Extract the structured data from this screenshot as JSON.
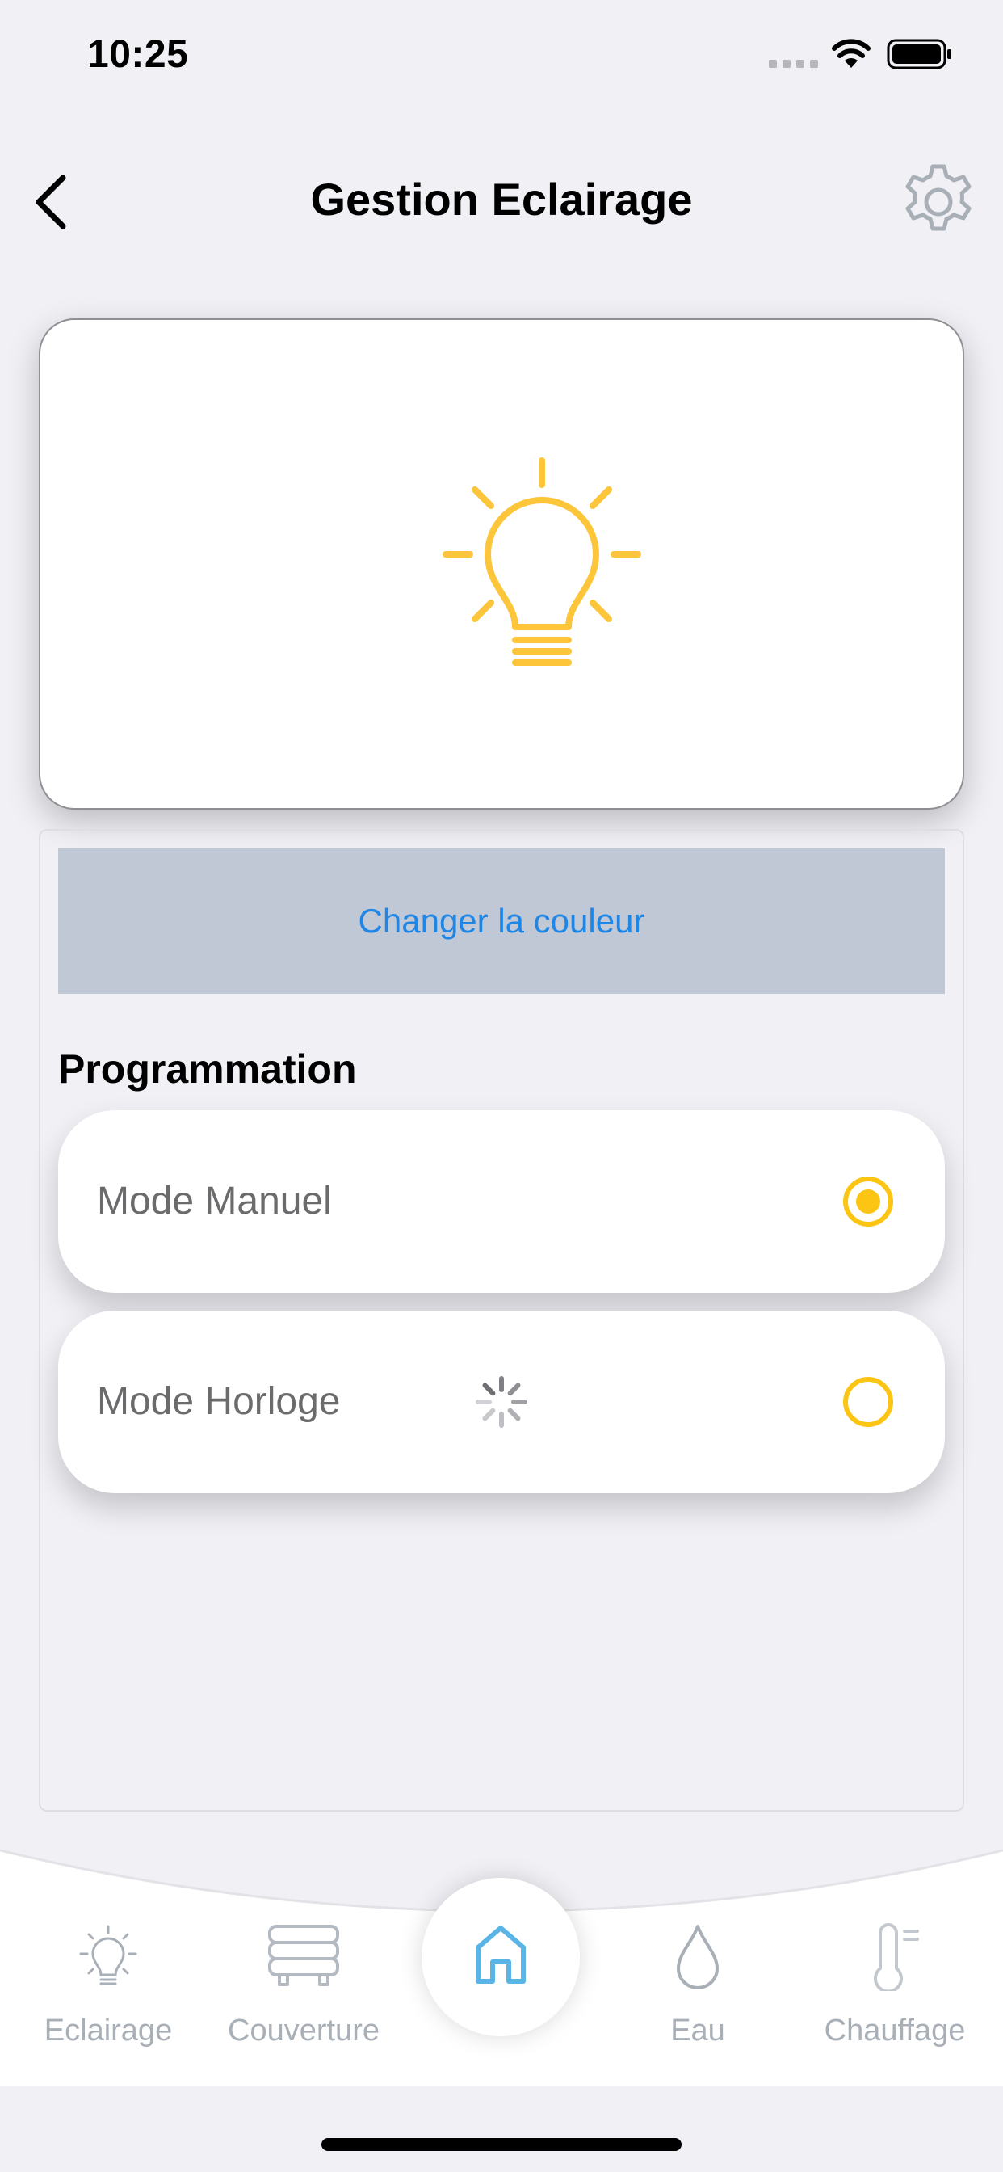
{
  "status_bar": {
    "time": "10:25",
    "signal_icon": "cellular-signal-icon",
    "wifi_icon": "wifi-icon",
    "battery_icon": "battery-icon"
  },
  "header": {
    "title": "Gestion Eclairage",
    "back_icon": "chevron-left-icon",
    "settings_icon": "gear-icon"
  },
  "hero": {
    "icon": "lightbulb-icon",
    "color": "#fcc53a"
  },
  "actions": {
    "change_color_label": "Changer la couleur"
  },
  "programmation": {
    "title": "Programmation",
    "modes": [
      {
        "label": "Mode Manuel",
        "selected": true
      },
      {
        "label": "Mode Horloge",
        "selected": false,
        "loading": true
      }
    ]
  },
  "tab_bar": {
    "tabs": [
      {
        "label": "Eclairage",
        "icon": "lightbulb-icon"
      },
      {
        "label": "Couverture",
        "icon": "pool-cover-icon"
      },
      {
        "label": "",
        "icon": "home-icon",
        "active": true
      },
      {
        "label": "Eau",
        "icon": "water-drop-icon"
      },
      {
        "label": "Chauffage",
        "icon": "thermometer-icon"
      }
    ]
  },
  "colors": {
    "accent_yellow": "#fcc514",
    "link_blue": "#1f86e6",
    "button_bg": "#c0c8d5",
    "home_active": "#5ab4e6",
    "tab_inactive": "#a9afb7"
  }
}
